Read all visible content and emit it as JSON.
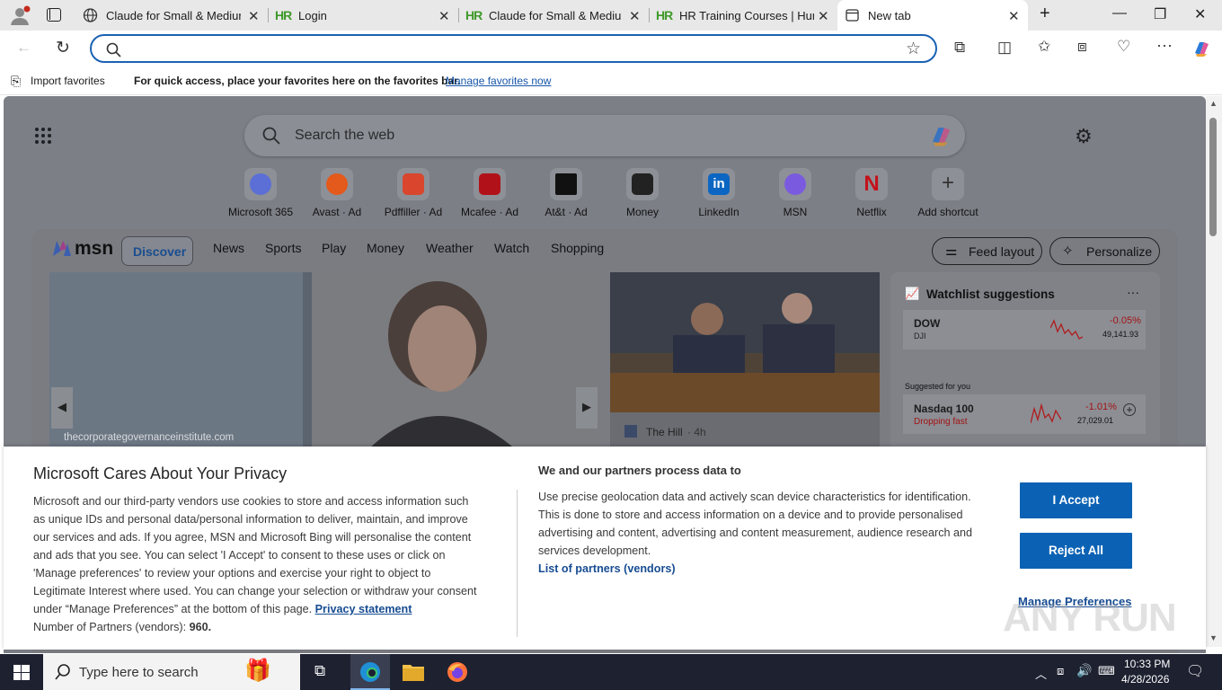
{
  "tabs": [
    {
      "title": "Claude for Small & Medium",
      "icon": "globe-icon"
    },
    {
      "title": "Login",
      "icon": "hr-logo-icon"
    },
    {
      "title": "Claude for Small & Medium",
      "icon": "hr-logo-icon"
    },
    {
      "title": "HR Training Courses | Huma",
      "icon": "hr-logo-icon"
    },
    {
      "title": "New tab",
      "icon": "new-tab-icon"
    }
  ],
  "hr_logo_text": "HR",
  "address": {
    "value": "",
    "placeholder": ""
  },
  "favorites": {
    "import": "Import favorites",
    "message": "For quick access, place your favorites here on the favorites bar.",
    "manage": "Manage favorites now"
  },
  "newtab": {
    "search_placeholder": "Search the web",
    "shortcuts": [
      {
        "label": "Microsoft 365",
        "color": "#5b6fd6"
      },
      {
        "label": "Avast · Ad",
        "color": "#e35a1c"
      },
      {
        "label": "Pdffiller · Ad",
        "color": "#d9462d"
      },
      {
        "label": "Mcafee · Ad",
        "color": "#b1121a"
      },
      {
        "label": "At&t · Ad",
        "color": "#111111"
      },
      {
        "label": "Money",
        "color": "#222222"
      },
      {
        "label": "LinkedIn",
        "color": "#0a66c2"
      },
      {
        "label": "MSN",
        "color": "#7a5be0"
      },
      {
        "label": "Netflix",
        "color": "#c4121a"
      },
      {
        "label": "Add shortcut",
        "color": ""
      }
    ]
  },
  "feed": {
    "brand": "msn",
    "nav": [
      "Discover",
      "News",
      "Sports",
      "Play",
      "Money",
      "Weather",
      "Watch",
      "Shopping"
    ],
    "feed_layout": "Feed layout",
    "personalize": "Personalize",
    "hero_source": "thecorporategovernanceinstitute.com",
    "news_source": "The Hill",
    "news_time": "· 4h",
    "watchlist": {
      "title": "Watchlist suggestions",
      "more": "···",
      "items": [
        {
          "name": "DOW",
          "sub": "DJI",
          "change": "-0.05%",
          "value": "49,141.93"
        }
      ],
      "suggested_label": "Suggested for you",
      "suggested": [
        {
          "name": "Nasdaq 100",
          "sub": "Dropping fast",
          "change": "-1.01%",
          "value": "27,029.01"
        }
      ]
    }
  },
  "consent": {
    "title": "Microsoft Cares About Your Privacy",
    "body_lines": [
      "Microsoft and our third-party vendors use cookies to store and access information such",
      "as unique IDs and personal data/personal information to deliver, maintain, and improve",
      "our services and ads. If you agree, MSN and Microsoft Bing will personalise the content",
      "and ads that you see. You can select 'I Accept' to consent to these uses or click on",
      "'Manage preferences' to review your options and exercise your right to object to",
      "Legitimate Interest where used. You can change your selection or withdraw your consent"
    ],
    "last_line": "under “Manage Preferences” at the bottom of this page.",
    "privacy_link": "Privacy statement",
    "partners_label": "Number of Partners (vendors):",
    "partners_count": "960.",
    "right_title": "We and our partners process data to",
    "right_lines": [
      "Use precise geolocation data and actively scan device characteristics for identification.",
      "This is done to store and access information on a device and to provide personalised",
      "advertising and content, advertising and content measurement, audience research and",
      "services development."
    ],
    "partners_link": "List of partners (vendors)",
    "accept": "I Accept",
    "reject": "Reject All",
    "manage": "Manage Preferences"
  },
  "watermark": "ANY RUN",
  "taskbar": {
    "search_placeholder": "Type here to search",
    "time": "10:33 PM",
    "date": "4/28/2026"
  }
}
